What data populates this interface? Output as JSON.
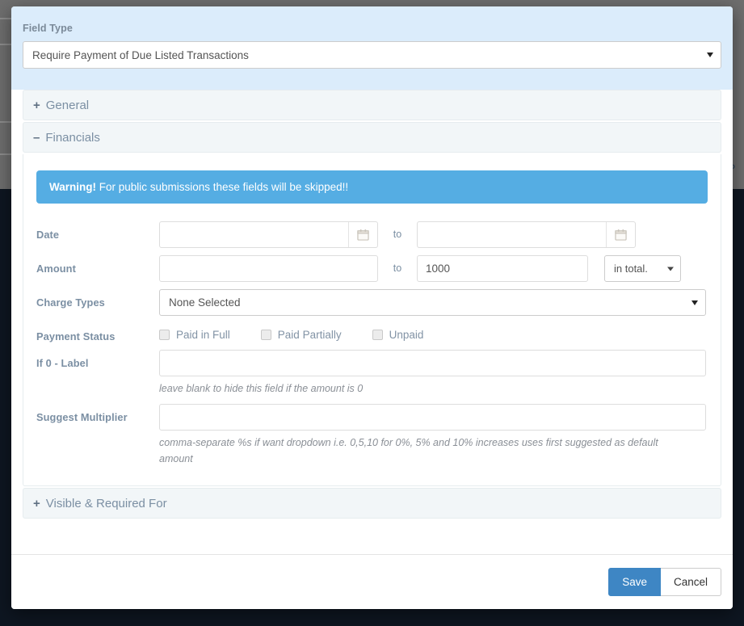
{
  "backdrop": {
    "partial_text": "P"
  },
  "modal": {
    "field_type": {
      "label": "Field Type",
      "value": "Require Payment of Due Listed Transactions",
      "caret_icon": "chevron-down-icon"
    },
    "accordions": [
      {
        "sign": "+",
        "label": "General",
        "expanded": false
      },
      {
        "sign": "–",
        "label": "Financials",
        "expanded": true
      },
      {
        "sign": "+",
        "label": "Visible & Required For",
        "expanded": false
      }
    ],
    "financials": {
      "alert": {
        "strong": "Warning!",
        "text": " For public submissions these fields will be skipped!!",
        "color": "#55ade3"
      },
      "date": {
        "label": "Date",
        "from_value": "",
        "to_label": "to",
        "to_value": "",
        "calendar_icon": "calendar-icon"
      },
      "amount": {
        "label": "Amount",
        "from_value": "",
        "to_label": "to",
        "to_value": "1000",
        "unit_value": "in total.",
        "unit_caret": "chevron-down-icon"
      },
      "charge_types": {
        "label": "Charge Types",
        "value": "None Selected",
        "caret_icon": "chevron-down-icon"
      },
      "payment_status": {
        "label": "Payment Status",
        "options": [
          {
            "label": "Paid in Full",
            "checked": false
          },
          {
            "label": "Paid Partially",
            "checked": false
          },
          {
            "label": "Unpaid",
            "checked": false
          }
        ]
      },
      "if_zero_label": {
        "label": "If 0 - Label",
        "value": "",
        "help": "leave blank to hide this field if the amount is 0"
      },
      "suggest_multiplier": {
        "label": "Suggest Multiplier",
        "value": "",
        "help": "comma-separate %s if want dropdown i.e. 0,5,10 for 0%, 5% and 10% increases uses first suggested as default amount"
      }
    },
    "footer": {
      "save_label": "Save",
      "cancel_label": "Cancel",
      "save_color": "#3e86c4"
    }
  }
}
